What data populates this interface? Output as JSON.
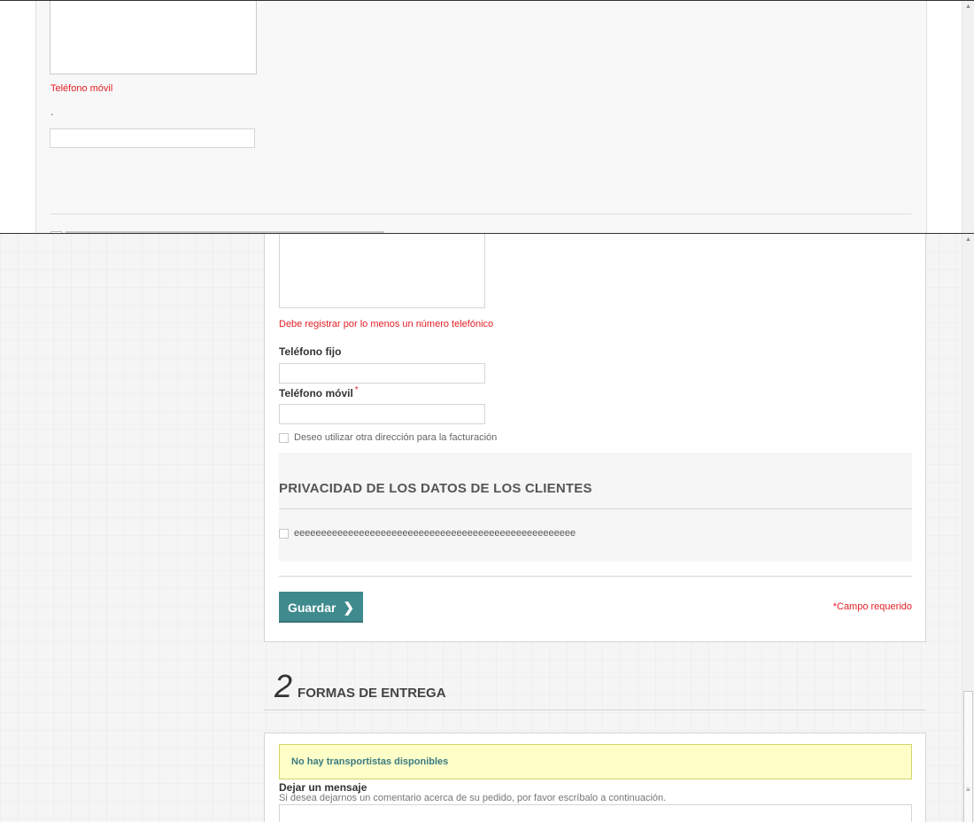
{
  "top_window": {
    "mobile_label": "Teléfono móvil",
    "dot": "."
  },
  "form": {
    "phone_error": "Debe registrar por lo menos un número telefónico",
    "landline_label": "Teléfono fijo",
    "mobile_label": "Teléfono móvil",
    "required_mark": "*",
    "invoice_address_checkbox": "Deseo utilizar otra dirección para la facturación",
    "privacy_title": "PRIVACIDAD DE LOS DATOS DE LOS CLIENTES",
    "privacy_checkbox": "eeeeeeeeeeeeeeeeeeeeeeeeeeeeeeeeeeeeeeeeeeeeeeeeeeee",
    "save_label": "Guardar",
    "save_icon": "chevron-right-icon",
    "required_note": "*Campo requerido"
  },
  "delivery": {
    "step_number": "2",
    "step_title": "FORMAS DE ENTREGA",
    "alert": "No hay transportistas disponibles",
    "message_label": "Dejar un mensaje",
    "message_help": "Si desea dejarnos un comentario acerca de su pedido, por favor escríbalo a continuación."
  },
  "colors": {
    "accent": "#3f8a8d",
    "error": "#e31e24",
    "alert_bg": "#fefec8"
  }
}
